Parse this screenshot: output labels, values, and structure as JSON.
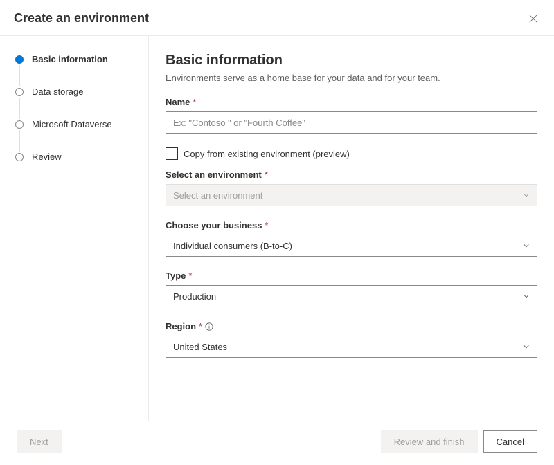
{
  "header": {
    "title": "Create an environment"
  },
  "sidebar": {
    "steps": [
      {
        "label": "Basic information",
        "active": true
      },
      {
        "label": "Data storage",
        "active": false
      },
      {
        "label": "Microsoft Dataverse",
        "active": false
      },
      {
        "label": "Review",
        "active": false
      }
    ]
  },
  "main": {
    "heading": "Basic information",
    "subtitle": "Environments serve as a home base for your data and for your team.",
    "name": {
      "label": "Name",
      "placeholder": "Ex: \"Contoso \" or \"Fourth Coffee\"",
      "value": ""
    },
    "copy_checkbox": {
      "label": "Copy from existing environment (preview)",
      "checked": false
    },
    "select_environment": {
      "label": "Select an environment",
      "value": "Select an environment",
      "disabled": true
    },
    "business": {
      "label": "Choose your business",
      "value": "Individual consumers (B-to-C)"
    },
    "type": {
      "label": "Type",
      "value": "Production"
    },
    "region": {
      "label": "Region",
      "value": "United States"
    }
  },
  "footer": {
    "next": "Next",
    "review": "Review and finish",
    "cancel": "Cancel"
  }
}
